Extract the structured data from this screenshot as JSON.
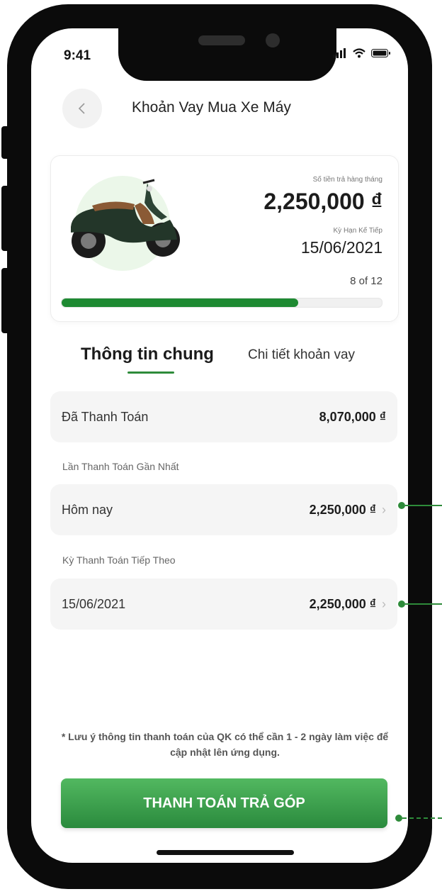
{
  "status_bar": {
    "time": "9:41"
  },
  "header": {
    "title": "Khoản Vay Mua Xe Máy"
  },
  "summary": {
    "monthly_label": "Số tiền trả hàng tháng",
    "monthly_amount": "2,250,000 ₫",
    "next_term_label": "Kỳ Hạn Kế Tiếp",
    "next_term_date": "15/06/2021",
    "progress_text": "8 of 12",
    "progress_fraction": 0.74,
    "accent": "#1e8a32"
  },
  "tabs": [
    {
      "label": "Thông tin chung",
      "active": true
    },
    {
      "label": "Chi tiết khoản vay",
      "active": false
    }
  ],
  "paid": {
    "label": "Đã Thanh Toán",
    "amount": "8,070,000 ₫"
  },
  "last_payment": {
    "section_label": "Lần Thanh Toán Gần Nhất",
    "label": "Hôm nay",
    "amount": "2,250,000 ₫"
  },
  "next_payment": {
    "section_label": "Kỳ Thanh Toán Tiếp Theo",
    "label": "15/06/2021",
    "amount": "2,250,000 ₫"
  },
  "note": "* Lưu ý thông tin thanh toán của QK có thể cần 1 - 2 ngày làm việc để cập nhật lên ứng dụng.",
  "pay_button": {
    "label": "THANH TOÁN TRẢ GÓP"
  },
  "icons": {
    "back": "chevron-left-icon",
    "chevron": "chevron-right-icon",
    "signal": "signal-icon",
    "wifi": "wifi-icon",
    "battery": "battery-icon",
    "scooter": "scooter-image"
  }
}
